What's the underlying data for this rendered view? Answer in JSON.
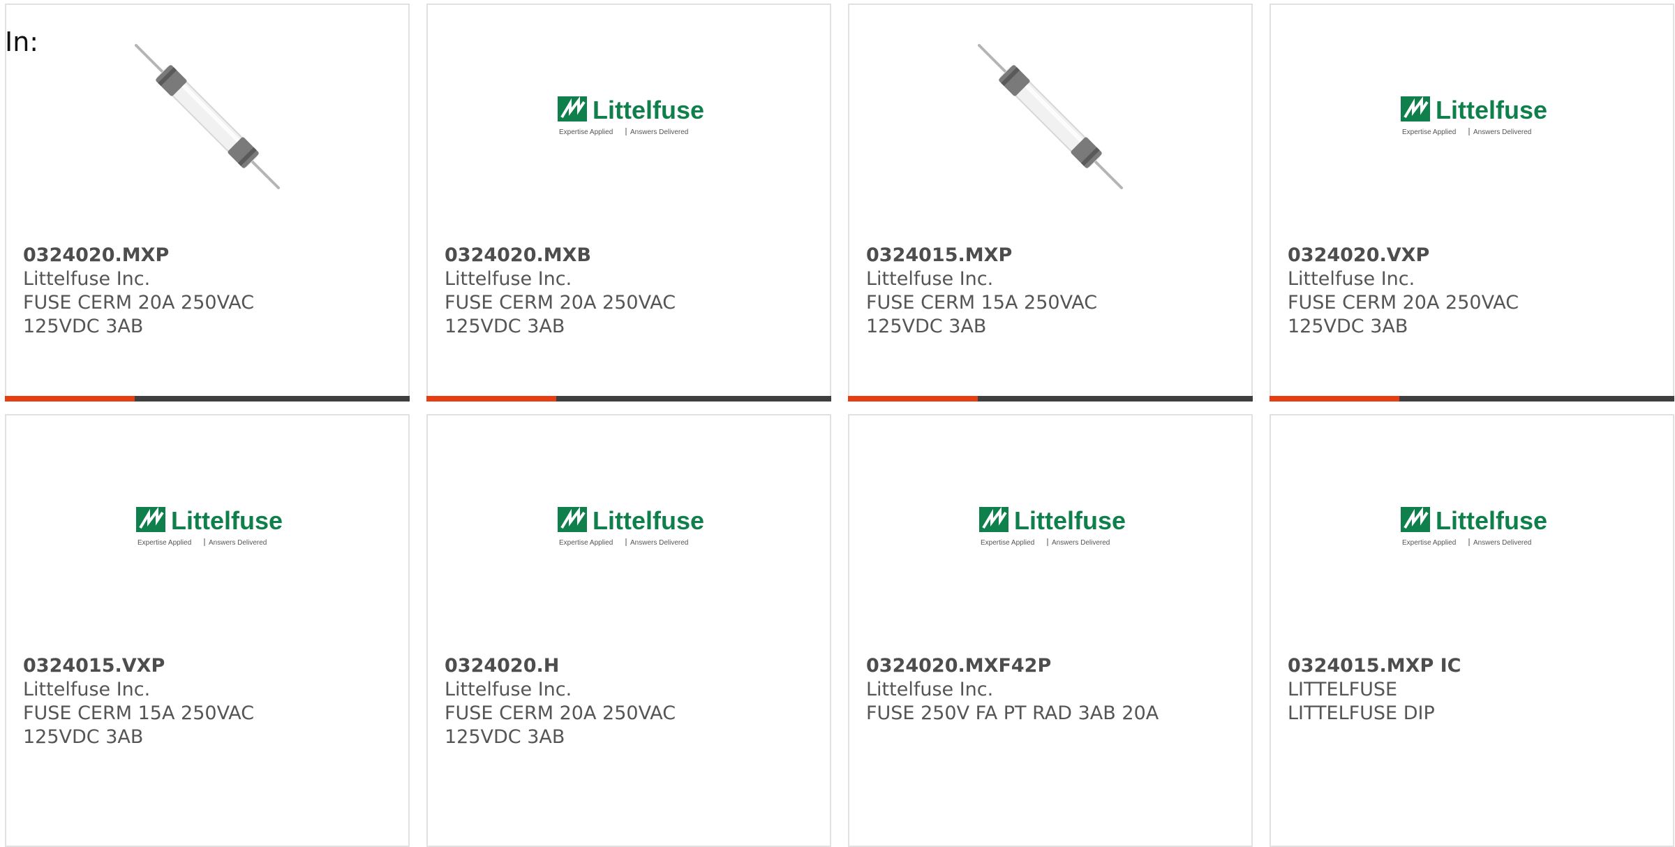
{
  "header": {
    "in_label": "In:"
  },
  "colors": {
    "accent": "#e63d12",
    "bar_track": "#3f3f3f",
    "brand_green": "#0f7f4b"
  },
  "logo": {
    "name": "Littelfuse",
    "tagline_left": "Expertise Applied",
    "tagline_right": "Answers Delivered"
  },
  "products": [
    {
      "part_number": "0324020.MXP",
      "manufacturer": "Littelfuse Inc.",
      "description": "FUSE CERM 20A 250VAC 125VDC 3AB",
      "image": "fuse-photo",
      "progress": 0.32
    },
    {
      "part_number": "0324020.MXB",
      "manufacturer": "Littelfuse Inc.",
      "description": "FUSE CERM 20A 250VAC 125VDC 3AB",
      "image": "littelfuse-logo",
      "progress": 0.32
    },
    {
      "part_number": "0324015.MXP",
      "manufacturer": "Littelfuse Inc.",
      "description": "FUSE CERM 15A 250VAC 125VDC 3AB",
      "image": "fuse-photo",
      "progress": 0.32
    },
    {
      "part_number": "0324020.VXP",
      "manufacturer": "Littelfuse Inc.",
      "description": "FUSE CERM 20A 250VAC 125VDC 3AB",
      "image": "littelfuse-logo",
      "progress": 0.32
    },
    {
      "part_number": "0324015.VXP",
      "manufacturer": "Littelfuse Inc.",
      "description": "FUSE CERM 15A 250VAC 125VDC 3AB",
      "image": "littelfuse-logo"
    },
    {
      "part_number": "0324020.H",
      "manufacturer": "Littelfuse Inc.",
      "description": "FUSE CERM 20A 250VAC 125VDC 3AB",
      "image": "littelfuse-logo"
    },
    {
      "part_number": "0324020.MXF42P",
      "manufacturer": "Littelfuse Inc.",
      "description": "FUSE 250V FA PT RAD 3AB 20A",
      "image": "littelfuse-logo"
    },
    {
      "part_number": "0324015.MXP IC",
      "manufacturer": "LITTELFUSE",
      "description": "LITTELFUSE DIP",
      "image": "littelfuse-logo"
    }
  ]
}
